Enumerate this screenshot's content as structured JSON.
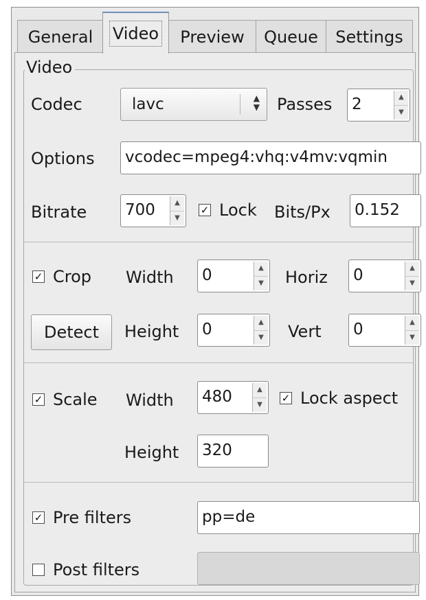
{
  "tabs": [
    {
      "label": "General",
      "active": false
    },
    {
      "label": "Video",
      "active": true
    },
    {
      "label": "Preview",
      "active": false
    },
    {
      "label": "Queue",
      "active": false
    },
    {
      "label": "Settings",
      "active": false
    }
  ],
  "group_title": "Video",
  "codec": {
    "label": "Codec",
    "value": "lavc"
  },
  "passes": {
    "label": "Passes",
    "value": "2"
  },
  "options": {
    "label": "Options",
    "value": "vcodec=mpeg4:vhq:v4mv:vqmin"
  },
  "bitrate": {
    "label": "Bitrate",
    "value": "700",
    "lock_label": "Lock",
    "lock_checked": true
  },
  "bits_px": {
    "label": "Bits/Px",
    "value": "0.152"
  },
  "crop": {
    "label": "Crop",
    "checked": true,
    "width_label": "Width",
    "width_value": "0",
    "height_label": "Height",
    "height_value": "0",
    "horiz_label": "Horiz",
    "horiz_value": "0",
    "vert_label": "Vert",
    "vert_value": "0",
    "detect_label": "Detect"
  },
  "scale": {
    "label": "Scale",
    "checked": true,
    "width_label": "Width",
    "width_value": "480",
    "height_label": "Height",
    "height_value": "320",
    "lock_aspect_label": "Lock aspect",
    "lock_aspect_checked": true
  },
  "pre_filters": {
    "label": "Pre filters",
    "checked": true,
    "value": "pp=de"
  },
  "post_filters": {
    "label": "Post filters",
    "checked": false,
    "value": ""
  },
  "icons": {
    "check": "checkmark-icon",
    "spin": "spin-arrows-icon",
    "combo": "combo-arrows-icon"
  },
  "colors": {
    "active_tab_accent": "#6f8fb7",
    "panel_bg": "#ececec"
  }
}
